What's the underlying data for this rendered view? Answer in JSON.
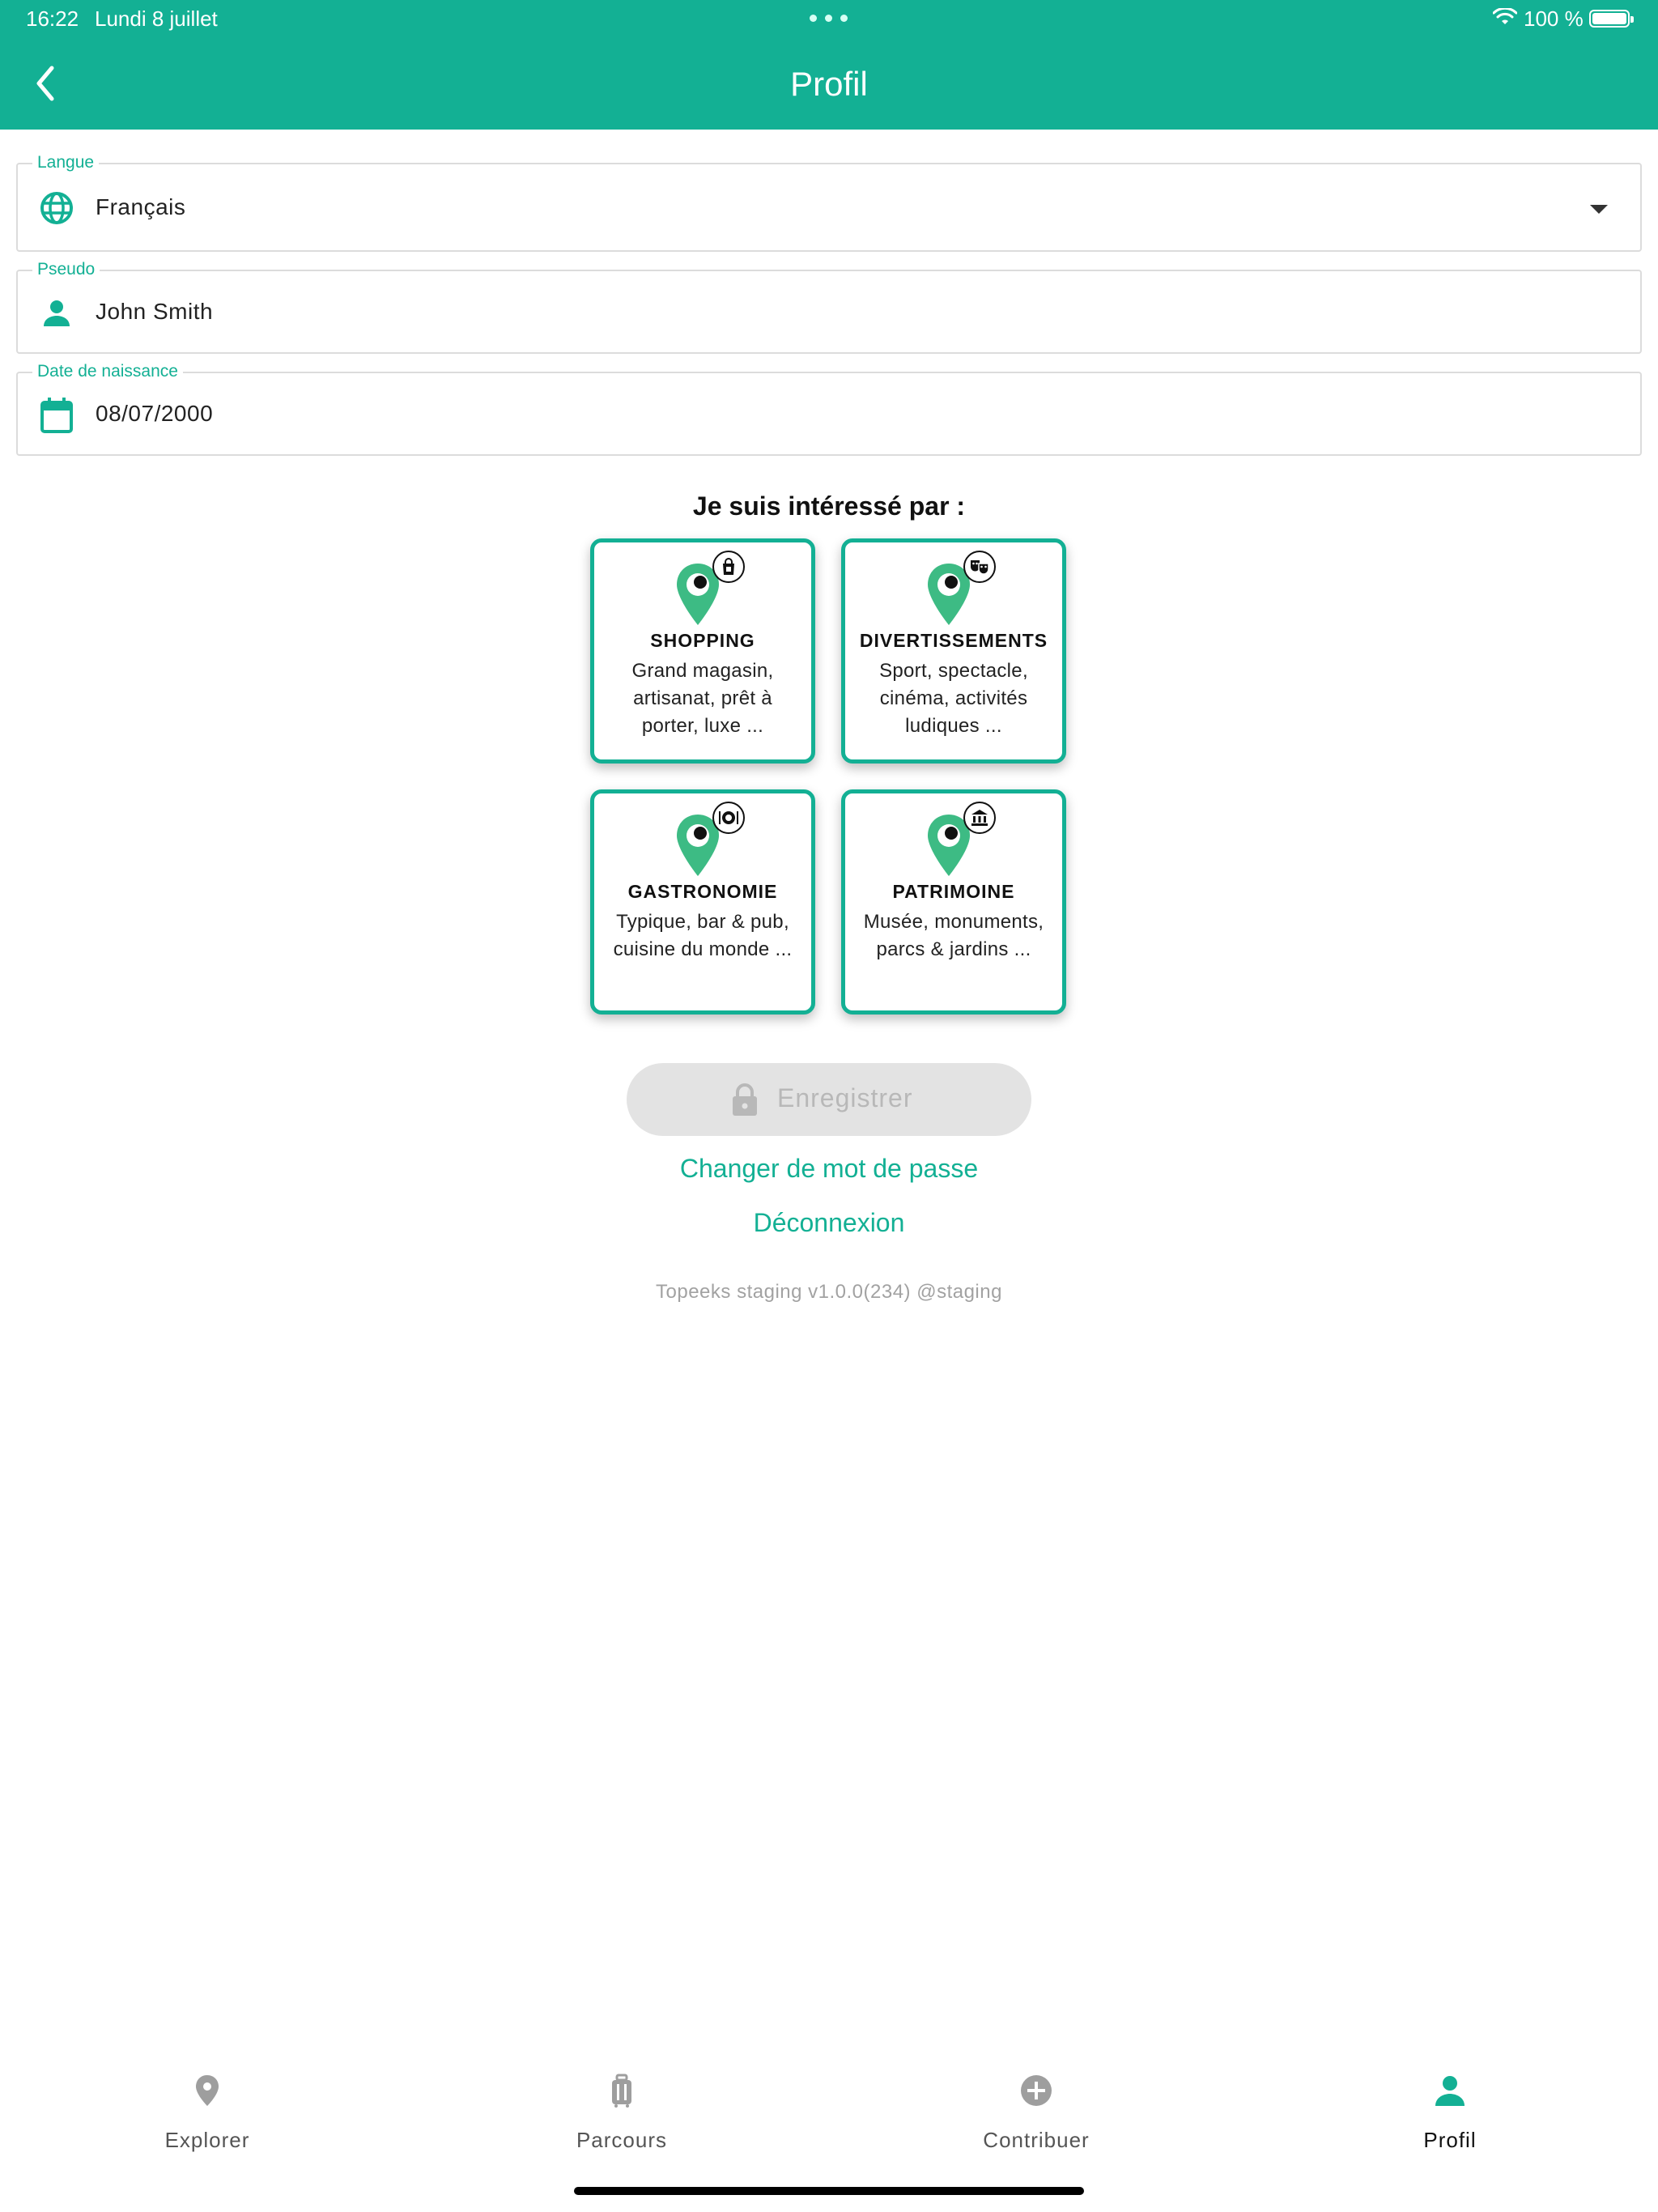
{
  "status_bar": {
    "time": "16:22",
    "date": "Lundi 8 juillet",
    "battery": "100 %"
  },
  "header": {
    "title": "Profil",
    "back_icon": "chevron-left-icon"
  },
  "form": {
    "language": {
      "label": "Langue",
      "value": "Français",
      "icon": "globe-icon"
    },
    "pseudo": {
      "label": "Pseudo",
      "value": "John Smith",
      "icon": "person-icon"
    },
    "birthdate": {
      "label": "Date de naissance",
      "value": "08/07/2000",
      "icon": "calendar-icon"
    }
  },
  "interests": {
    "title": "Je suis intéressé par :",
    "items": [
      {
        "name": "SHOPPING",
        "description": "Grand magasin, artisanat, prêt à porter, luxe ...",
        "icon": "shopping-bag-icon"
      },
      {
        "name": "DIVERTISSEMENTS",
        "description": "Sport, spectacle, cinéma, activités ludiques ...",
        "icon": "theater-masks-icon"
      },
      {
        "name": "GASTRONOMIE",
        "description": "Typique, bar & pub, cuisine du monde ...",
        "icon": "plate-cutlery-icon"
      },
      {
        "name": "PATRIMOINE",
        "description": "Musée, monuments, parcs & jardins ...",
        "icon": "museum-icon"
      }
    ]
  },
  "actions": {
    "save_label": "Enregistrer",
    "change_password": "Changer de mot de passe",
    "logout": "Déconnexion"
  },
  "version": "Topeeks staging v1.0.0(234) @staging",
  "nav": {
    "items": [
      {
        "label": "Explorer",
        "icon": "map-pin-icon"
      },
      {
        "label": "Parcours",
        "icon": "luggage-icon"
      },
      {
        "label": "Contribuer",
        "icon": "plus-circle-icon"
      },
      {
        "label": "Profil",
        "icon": "person-icon"
      }
    ],
    "active": "Profil"
  },
  "colors": {
    "primary": "#13b094",
    "pin": "#3dbb84",
    "disabled_bg": "#e3e3e3",
    "inactive_nav": "#9e9e9e"
  }
}
